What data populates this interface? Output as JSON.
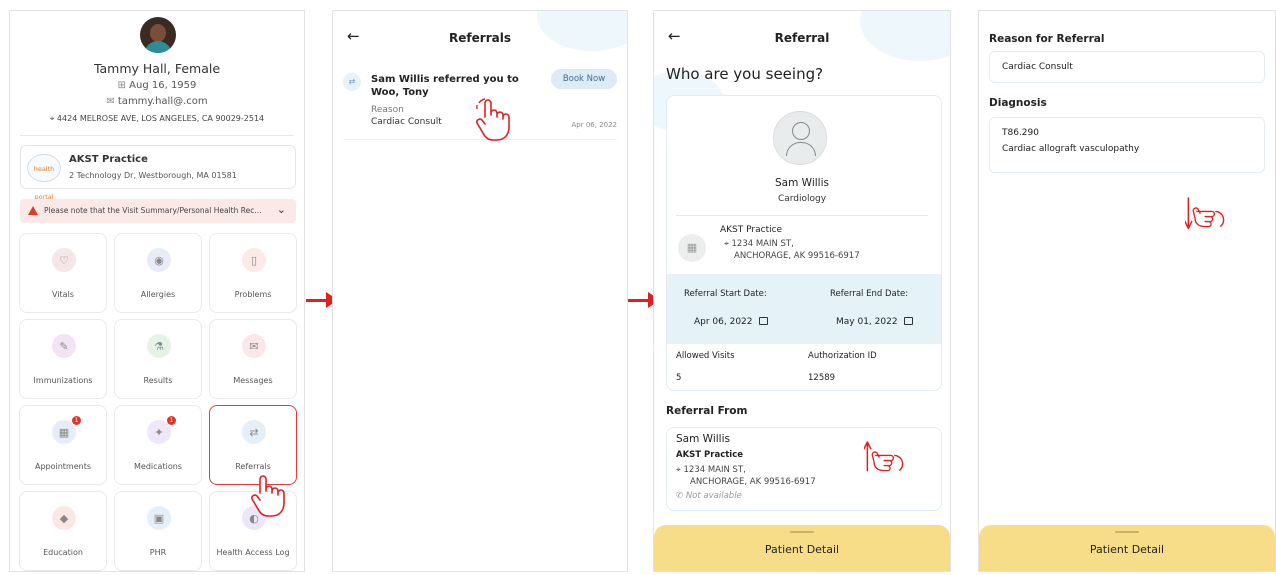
{
  "panel1": {
    "patient_name": "Tammy Hall, Female",
    "dob": "Aug 16, 1959",
    "email": "tammy.hall@.com",
    "address": "4424 MELROSE AVE, LOS ANGELES, CA 90029-2514",
    "practice_logo": "health portal",
    "practice_name": "AKST Practice",
    "practice_address": "2 Technology Dr, Westborough, MA 01581",
    "notice": "Please note that the Visit Summary/Personal Health Rec...",
    "tiles": [
      {
        "label": "Vitals",
        "icon": "heartbeat-icon",
        "color": "#f5e6e8",
        "glyph": "♡"
      },
      {
        "label": "Allergies",
        "icon": "allergy-icon",
        "color": "#e8ebf8",
        "glyph": "◉"
      },
      {
        "label": "Problems",
        "icon": "clipboard-icon",
        "color": "#fbeae6",
        "glyph": "▯"
      },
      {
        "label": "Immunizations",
        "icon": "syringe-icon",
        "color": "#f3e4f4",
        "glyph": "✎"
      },
      {
        "label": "Results",
        "icon": "flask-icon",
        "color": "#e4f3e6",
        "glyph": "⚗"
      },
      {
        "label": "Messages",
        "icon": "mail-icon",
        "color": "#fbe6e8",
        "glyph": "✉"
      },
      {
        "label": "Appointments",
        "icon": "calendar-icon",
        "color": "#e6edf8",
        "glyph": "▦",
        "badge": "1"
      },
      {
        "label": "Medications",
        "icon": "pill-icon",
        "color": "#f1e6f7",
        "glyph": "✦",
        "badge": "1"
      },
      {
        "label": "Referrals",
        "icon": "referral-icon",
        "color": "#e4eff7",
        "glyph": "⇄"
      },
      {
        "label": "Education",
        "icon": "graduation-cap-icon",
        "color": "#fbe8e4",
        "glyph": "◆"
      },
      {
        "label": "PHR",
        "icon": "document-icon",
        "color": "#e5eff8",
        "glyph": "▣"
      },
      {
        "label": "Health Access Log",
        "icon": "access-log-icon",
        "color": "#ece6f6",
        "glyph": "◐"
      }
    ]
  },
  "panel2": {
    "title": "Referrals",
    "referral_title": "Sam Willis referred you to Woo, Tony",
    "book_label": "Book Now",
    "reason_label": "Reason",
    "reason_value": "Cardiac Consult",
    "date": "Apr 06, 2022"
  },
  "panel3": {
    "title": "Referral",
    "question": "Who are you seeing?",
    "doctor_name": "Sam Willis",
    "doctor_specialty": "Cardiology",
    "practice_name": "AKST Practice",
    "practice_addr1": "1234 MAIN ST,",
    "practice_addr2": "ANCHORAGE, AK 99516-6917",
    "start_label": "Referral Start Date:",
    "end_label": "Referral End Date:",
    "start_value": "Apr 06, 2022",
    "end_value": "May 01, 2022",
    "visits_label": "Allowed Visits",
    "visits_value": "5",
    "auth_label": "Authorization ID",
    "auth_value": "12589",
    "from_heading": "Referral From",
    "from_name": "Sam Willis",
    "from_practice": "AKST Practice",
    "from_addr1": "1234 MAIN ST,",
    "from_addr2": "ANCHORAGE, AK 99516-6917",
    "from_phone": "Not available",
    "footer": "Patient Detail"
  },
  "panel4": {
    "reason_heading": "Reason for Referral",
    "reason_value": "Cardiac Consult",
    "diagnosis_heading": "Diagnosis",
    "diagnosis_code": "T86.290",
    "diagnosis_desc": "Cardiac allograft vasculopathy",
    "footer": "Patient Detail"
  },
  "colors": {
    "accent_red": "#e02020",
    "footer_yellow": "#f7dd88",
    "band_blue": "#e5f2f7"
  }
}
